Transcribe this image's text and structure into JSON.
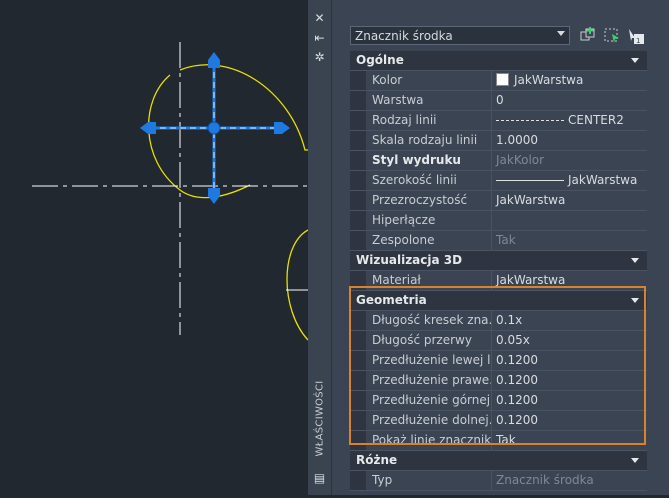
{
  "palette": {
    "title": "WŁAŚCIWOŚCI",
    "close_icon": "close-icon",
    "pin_icon": "pin-icon",
    "settings_icon": "settings-icon"
  },
  "selector": {
    "value": "Znacznik środka"
  },
  "toolbar": {
    "add_icon": "add-to-selection-icon",
    "quick_select_icon": "quick-select-icon",
    "pickadd_icon": "toggle-pickadd-icon"
  },
  "sections": [
    {
      "title": "Ogólne",
      "rows": [
        {
          "label": "Kolor",
          "value": "JakWarstwa",
          "swatch": "#ffffff"
        },
        {
          "label": "Warstwa",
          "value": "0"
        },
        {
          "label": "Rodzaj linii",
          "value": "CENTER2",
          "line": "dashdot"
        },
        {
          "label": "Skala rodzaju linii",
          "value": "1.0000"
        },
        {
          "label": "Styl wydruku",
          "value": "JakKolor",
          "bold": true,
          "dim": true
        },
        {
          "label": "Szerokość linii",
          "value": "JakWarstwa",
          "line": "solid"
        },
        {
          "label": "Przezroczystość",
          "value": "JakWarstwa"
        },
        {
          "label": "Hiperłącze",
          "value": ""
        },
        {
          "label": "Zespolone",
          "value": "Tak",
          "dim": true
        }
      ]
    },
    {
      "title": "Wizualizacja 3D",
      "rows": [
        {
          "label": "Materiał",
          "value": "JakWarstwa"
        }
      ]
    },
    {
      "title": "Geometria",
      "rows": [
        {
          "label": "Długość kresek zna...",
          "value": "0.1x"
        },
        {
          "label": "Długość przerwy",
          "value": "0.05x"
        },
        {
          "label": "Przedłużenie lewej l...",
          "value": "0.1200"
        },
        {
          "label": "Przedłużenie prawe...",
          "value": "0.1200"
        },
        {
          "label": "Przedłużenie górnej...",
          "value": "0.1200"
        },
        {
          "label": "Przedłużenie dolnej...",
          "value": "0.1200"
        },
        {
          "label": "Pokaż linie znacznika",
          "value": "Tak"
        }
      ]
    },
    {
      "title": "Różne",
      "rows": [
        {
          "label": "Typ",
          "value": "Znacznik środka",
          "dim": true
        }
      ]
    }
  ],
  "colors": {
    "accent_orange": "#d9822b",
    "grip_blue": "#1e7ae0",
    "arc_yellow": "#e8e000",
    "centerline_white": "#ffffff"
  }
}
